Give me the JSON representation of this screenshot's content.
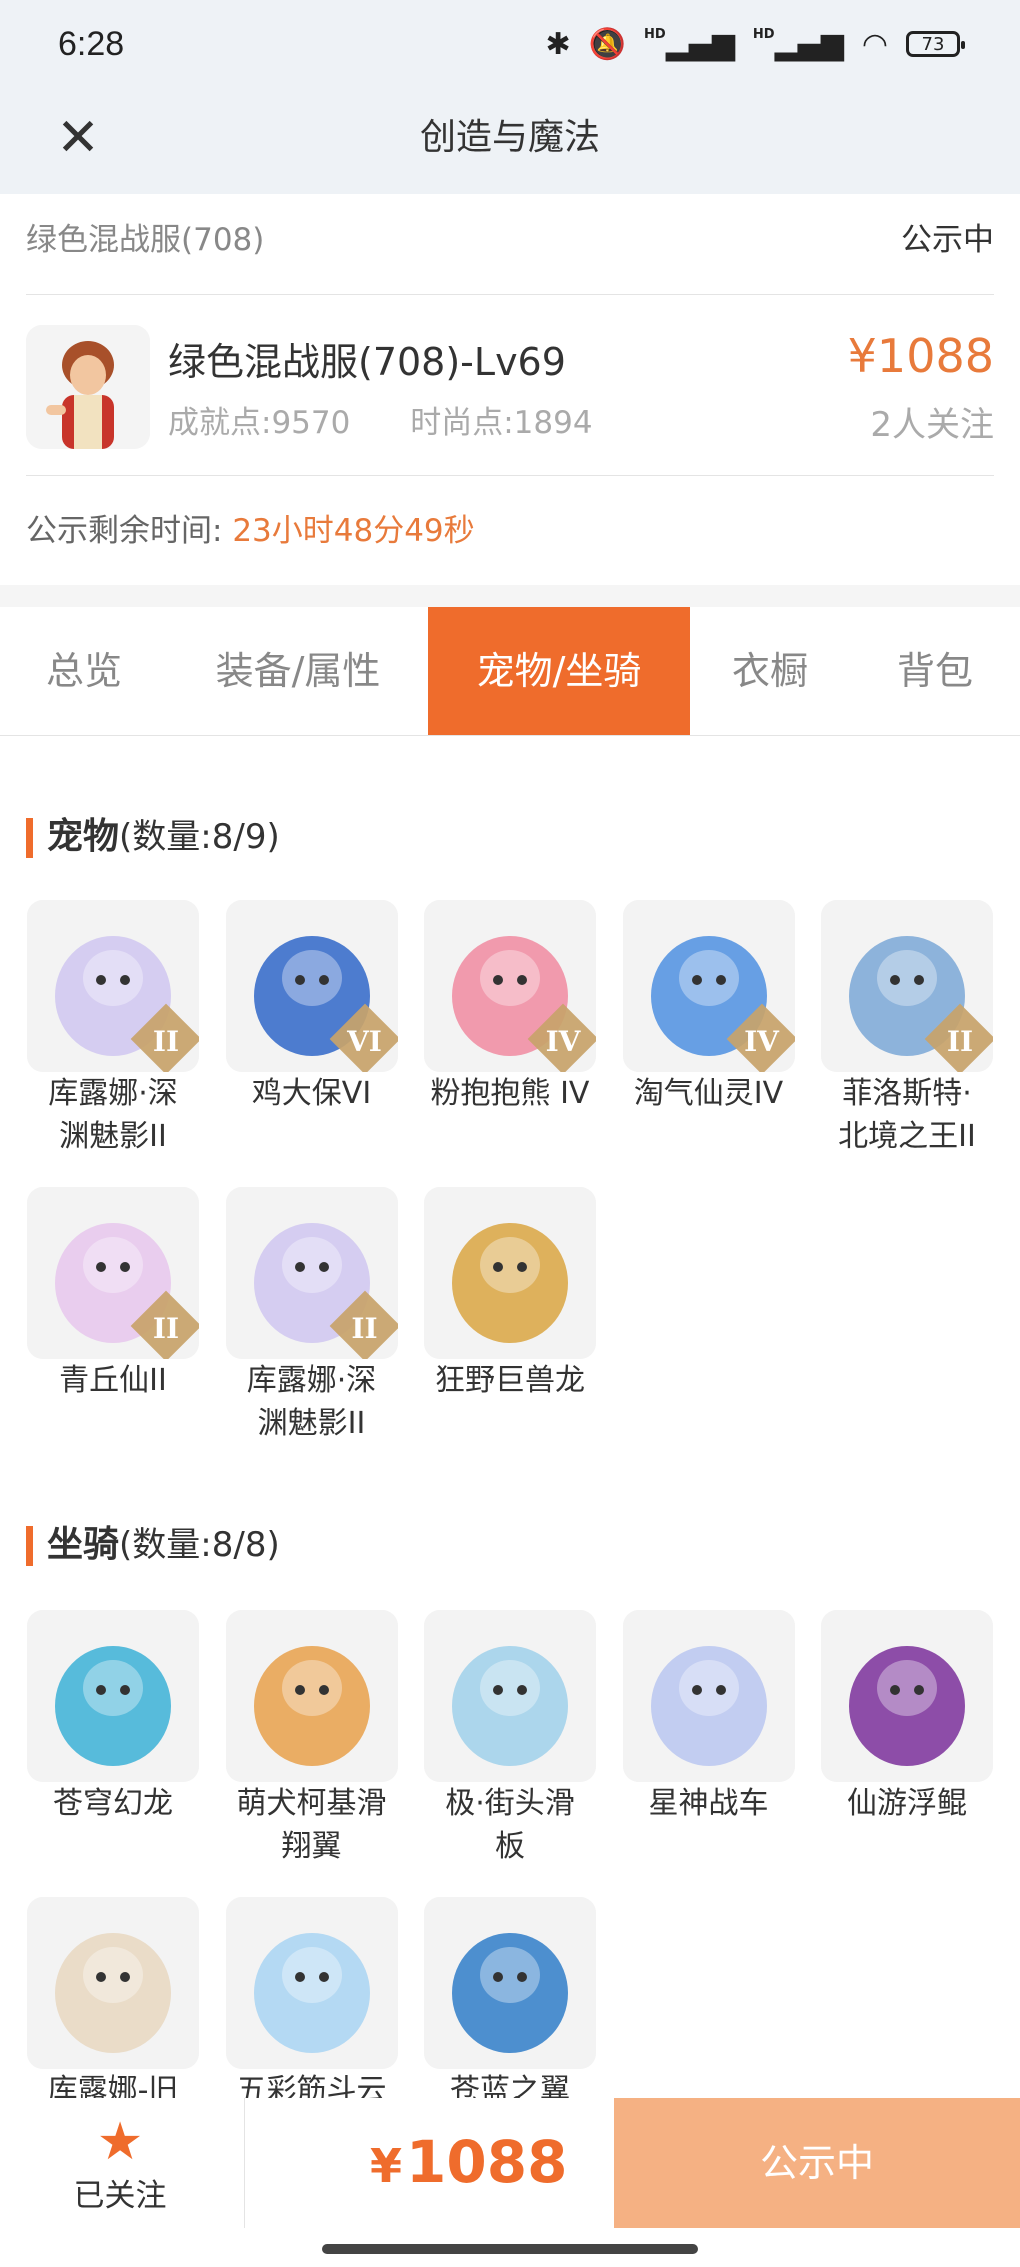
{
  "status_bar": {
    "time": "6:28",
    "battery": "73"
  },
  "header": {
    "title": "创造与魔法"
  },
  "listing": {
    "name": "绿色混战服(708)",
    "status": "公示中"
  },
  "role": {
    "title": "绿色混战服(708)-Lv69",
    "achievement": "成就点:9570",
    "fashion": "时尚点:1894",
    "price": "¥1088",
    "followers": "2人关注"
  },
  "countdown": {
    "label": "公示剩余时间:",
    "value": "23小时48分49秒"
  },
  "tabs": [
    {
      "label": "总览"
    },
    {
      "label": "装备/属性"
    },
    {
      "label": "宠物/坐骑"
    },
    {
      "label": "衣橱"
    },
    {
      "label": "背包"
    }
  ],
  "pets": {
    "title": "宠物",
    "count": "(数量:8/9)",
    "items": [
      {
        "line1": "库露娜·深",
        "line2": "渊魅影II",
        "badge": "II",
        "color": "#cfc6f0"
      },
      {
        "line1": "鸡大保VI",
        "line2": "",
        "badge": "VI",
        "color": "#2f66c8"
      },
      {
        "line1": "粉抱抱熊 IV",
        "line2": "",
        "badge": "IV",
        "color": "#f08aa0"
      },
      {
        "line1": "淘气仙灵IV",
        "line2": "",
        "badge": "IV",
        "color": "#4e8fe0"
      },
      {
        "line1": "菲洛斯特·",
        "line2": "北境之王II",
        "badge": "II",
        "color": "#7aa7d6"
      },
      {
        "line1": "青丘仙II",
        "line2": "",
        "badge": "II",
        "color": "#e6c6ec"
      },
      {
        "line1": "库露娜·深",
        "line2": "渊魅影II",
        "badge": "II",
        "color": "#cfc6f0"
      },
      {
        "line1": "狂野巨兽龙",
        "line2": "",
        "badge": "",
        "color": "#d9a441"
      }
    ]
  },
  "mounts": {
    "title": "坐骑",
    "count": "(数量:8/8)",
    "items": [
      {
        "line1": "苍穹幻龙",
        "line2": "",
        "color": "#3bb0d6"
      },
      {
        "line1": "萌犬柯基滑",
        "line2": "翔翼",
        "color": "#e7a04a"
      },
      {
        "line1": "极·街头滑",
        "line2": "板",
        "color": "#9fd0ea"
      },
      {
        "line1": "星神战车",
        "line2": "",
        "color": "#b9c6f0"
      },
      {
        "line1": "仙游浮鲲",
        "line2": "",
        "color": "#7a2f9a"
      },
      {
        "line1": "库露娜-旧",
        "line2": "",
        "color": "#e8d7c0"
      },
      {
        "line1": "五彩筋斗云",
        "line2": "",
        "color": "#a8d4f2"
      },
      {
        "line1": "苍蓝之翼",
        "line2": "",
        "color": "#2f7cc8"
      }
    ]
  },
  "bottom": {
    "follow_label": "已关注",
    "price": "1088",
    "currency": "¥",
    "cta": "公示中"
  },
  "colors": {
    "accent": "#ef6c2c",
    "price": "#e87a3b",
    "cta_disabled": "#f5b183"
  }
}
